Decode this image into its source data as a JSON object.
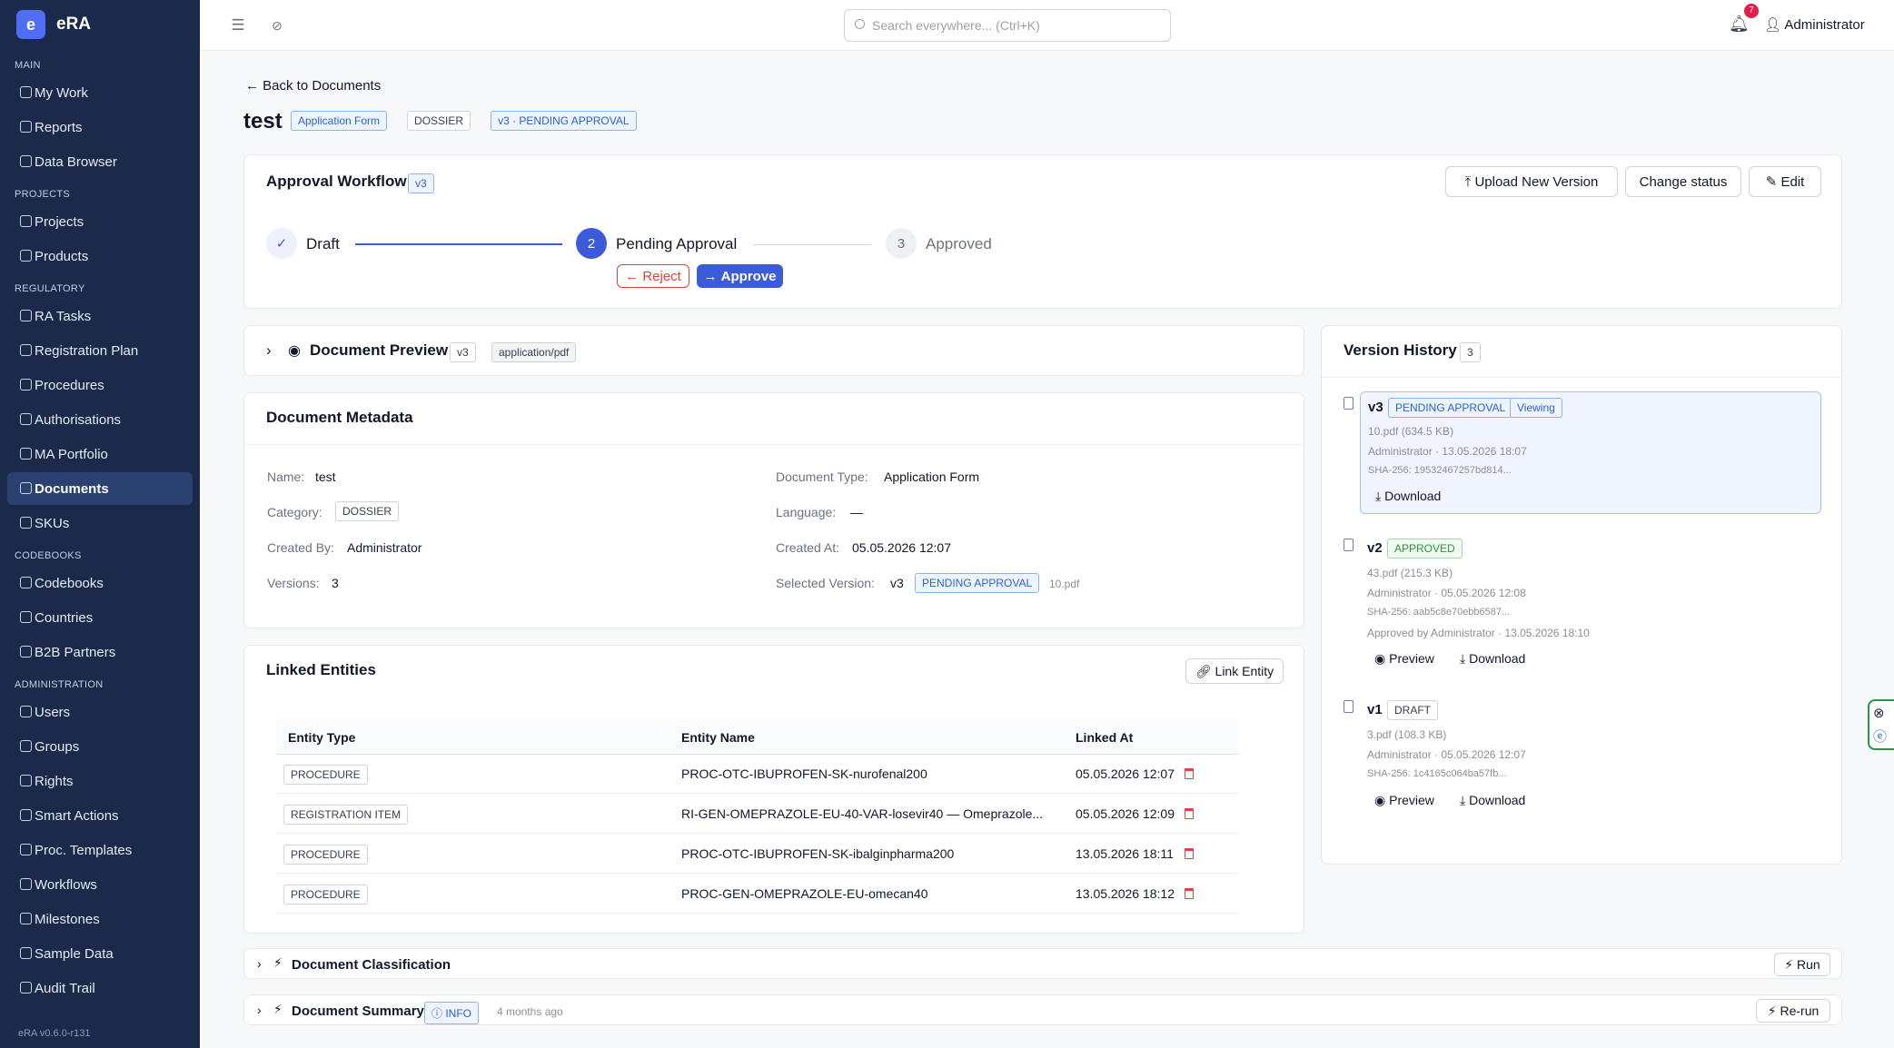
{
  "app": {
    "name": "eRA",
    "logo_letter": "e",
    "version": "eRA v0.6.0-r131"
  },
  "sidebar": {
    "sections": [
      {
        "label": "MAIN",
        "items": [
          "My Work",
          "Reports",
          "Data Browser"
        ]
      },
      {
        "label": "PROJECTS",
        "items": [
          "Projects",
          "Products"
        ]
      },
      {
        "label": "REGULATORY",
        "items": [
          "RA Tasks",
          "Registration Plan",
          "Procedures",
          "Authorisations",
          "MA Portfolio",
          "Documents",
          "SKUs"
        ]
      },
      {
        "label": "CODEBOOKS",
        "items": [
          "Codebooks",
          "Countries",
          "B2B Partners"
        ]
      },
      {
        "label": "ADMINISTRATION",
        "items": [
          "Users",
          "Groups",
          "Rights",
          "Smart Actions",
          "Proc. Templates",
          "Workflows",
          "Milestones",
          "Sample Data",
          "Audit Trail"
        ]
      }
    ],
    "active": "Documents"
  },
  "topbar": {
    "search_placeholder": "Search everywhere... (Ctrl+K)",
    "notifications": "7",
    "user": "Administrator"
  },
  "page": {
    "back_label": "Back to Documents",
    "title": "test",
    "tags": [
      "Application Form",
      "DOSSIER",
      "v3 · PENDING APPROVAL"
    ]
  },
  "workflow": {
    "title": "Approval Workflow",
    "version": "v3",
    "buttons": {
      "upload": "Upload New Version",
      "change_status": "Change status",
      "edit": "Edit"
    },
    "steps": [
      {
        "num": "",
        "label": "Draft"
      },
      {
        "num": "2",
        "label": "Pending Approval"
      },
      {
        "num": "3",
        "label": "Approved"
      }
    ],
    "reject": "Reject",
    "approve": "Approve"
  },
  "preview": {
    "title": "Document Preview",
    "version": "v3",
    "mime": "application/pdf"
  },
  "metadata": {
    "title": "Document Metadata",
    "name_label": "Name:",
    "name": "test",
    "category_label": "Category:",
    "category": "DOSSIER",
    "created_by_label": "Created By:",
    "created_by": "Administrator",
    "versions_label": "Versions:",
    "versions": "3",
    "doc_type_label": "Document Type:",
    "doc_type": "Application Form",
    "language_label": "Language:",
    "language": "—",
    "created_at_label": "Created At:",
    "created_at": "05.05.2026 12:07",
    "selected_label": "Selected Version:",
    "selected_version": "v3",
    "selected_status": "PENDING APPROVAL",
    "selected_file": "10.pdf"
  },
  "linked": {
    "title": "Linked Entities",
    "link_button": "Link Entity",
    "headers": [
      "Entity Type",
      "Entity Name",
      "Linked At"
    ],
    "rows": [
      {
        "type": "PROCEDURE",
        "name": "PROC-OTC-IBUPROFEN-SK-nurofenal200",
        "at": "05.05.2026 12:07"
      },
      {
        "type": "REGISTRATION ITEM",
        "name": "RI-GEN-OMEPRAZOLE-EU-40-VAR-losevir40 — Omeprazole...",
        "at": "05.05.2026 12:09"
      },
      {
        "type": "PROCEDURE",
        "name": "PROC-OTC-IBUPROFEN-SK-ibalginpharma200",
        "at": "13.05.2026 18:11"
      },
      {
        "type": "PROCEDURE",
        "name": "PROC-GEN-OMEPRAZOLE-EU-omecan40",
        "at": "13.05.2026 18:12"
      }
    ]
  },
  "history": {
    "title": "Version History",
    "count": "3",
    "versions": [
      {
        "v": "v3",
        "status": "PENDING APPROVAL",
        "viewing": "Viewing",
        "file": "10.pdf (634.5 KB)",
        "meta": "Administrator · 13.05.2026 18:07",
        "sha": "SHA-256: 19532467257bd814...",
        "download": "Download"
      },
      {
        "v": "v2",
        "status": "APPROVED",
        "file": "43.pdf (215.3 KB)",
        "meta": "Administrator · 05.05.2026 12:08",
        "sha": "SHA-256: aab5c8e70ebb6587...",
        "approved": "Approved by Administrator · 13.05.2026 18:10",
        "preview": "Preview",
        "download": "Download"
      },
      {
        "v": "v1",
        "status": "DRAFT",
        "file": "3.pdf (108.3 KB)",
        "meta": "Administrator · 05.05.2026 12:07",
        "sha": "SHA-256: 1c4165c064ba57fb...",
        "preview": "Preview",
        "download": "Download"
      }
    ]
  },
  "classification": {
    "title": "Document Classification",
    "run": "Run"
  },
  "summary": {
    "title": "Document Summary",
    "badge": "INFO",
    "time": "4 months ago",
    "rerun": "Re-run"
  },
  "colors": {
    "sidebar": "#1b2a4a",
    "accent": "#3b5bdb",
    "reject": "#e53e3e"
  }
}
